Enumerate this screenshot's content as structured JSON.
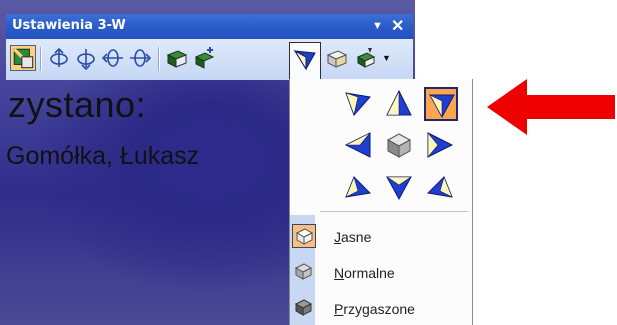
{
  "window": {
    "title": "Ustawienia 3-W"
  },
  "slide": {
    "line1": "zystano:",
    "line2": "Gomółka, Łukasz"
  },
  "toolbar": {
    "buttons": [
      "toggle-3d-icon",
      "tilt-down-icon",
      "tilt-up-icon",
      "tilt-left-icon",
      "tilt-right-icon",
      "depth-icon",
      "direction-icon",
      "lighting-icon",
      "surface-icon",
      "color-3d-icon"
    ]
  },
  "lighting_menu": {
    "grid": [
      "light-top-left-icon",
      "light-top-icon",
      "light-top-right-icon",
      "light-left-icon",
      "cube-icon",
      "light-right-icon",
      "light-bottom-left-icon",
      "light-bottom-icon",
      "light-bottom-right-icon"
    ],
    "selected_direction": "top-right",
    "options": [
      {
        "label": "Jasne",
        "accelerator": "J",
        "selected": true
      },
      {
        "label": "Normalne",
        "accelerator": "N",
        "selected": false
      },
      {
        "label": "Przygaszone",
        "accelerator": "P",
        "selected": false
      }
    ]
  },
  "colors": {
    "title_bar": "#2a5bc7",
    "highlight": "#ffa552",
    "arrow": "#ee0000",
    "slide_bg": "#2f2d8a"
  }
}
